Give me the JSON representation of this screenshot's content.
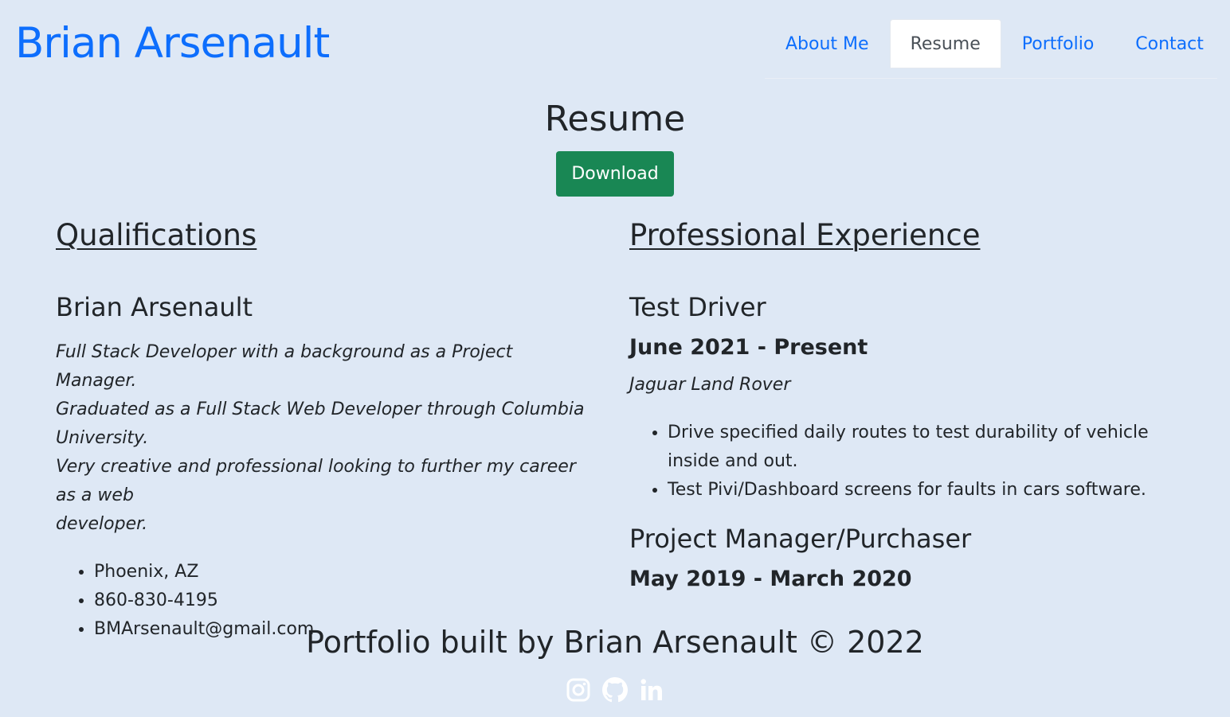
{
  "header": {
    "brand": "Brian Arsenault",
    "nav": [
      {
        "label": "About Me",
        "active": false
      },
      {
        "label": "Resume",
        "active": true
      },
      {
        "label": "Portfolio",
        "active": false
      },
      {
        "label": "Contact",
        "active": false
      }
    ]
  },
  "page": {
    "title": "Resume",
    "download_label": "Download"
  },
  "qualifications": {
    "heading": "Qualifications",
    "name": "Brian Arsenault",
    "bio_lines": [
      "Full Stack Developer with a background as a Project Manager.",
      "Graduated as a Full Stack Web Developer through Columbia University.",
      "Very creative and professional looking to further my career as a web",
      "developer."
    ],
    "contacts": [
      "Phoenix, AZ",
      "860-830-4195",
      "BMArsenault@gmail.com"
    ]
  },
  "experience": {
    "heading": "Professional Experience",
    "jobs": [
      {
        "title": "Test Driver",
        "dates": "June 2021 - Present",
        "company": "Jaguar Land Rover",
        "duties": [
          "Drive specified daily routes to test durability of vehicle inside and out.",
          "Test Pivi/Dashboard screens for faults in cars software."
        ]
      },
      {
        "title": "Project Manager/Purchaser",
        "dates": "May 2019 - March 2020"
      }
    ]
  },
  "footer": {
    "text": "Portfolio built by Brian Arsenault © 2022",
    "icons": [
      "instagram-icon",
      "github-icon",
      "linkedin-icon"
    ]
  },
  "colors": {
    "background": "#dee8f5",
    "brand": "#0d6efd",
    "download_button": "#198754",
    "text": "#212529"
  }
}
